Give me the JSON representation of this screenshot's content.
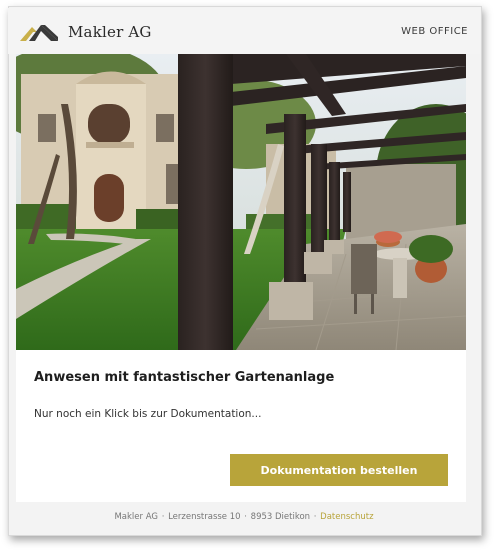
{
  "header": {
    "brand": "Makler AG",
    "logo_icon": "house-roof-logo-icon",
    "web_office_label": "WEB OFFICE"
  },
  "hero": {
    "image": "villa-garden-pergola-photo"
  },
  "content": {
    "title": "Anwesen mit fantastischer Gartenanlage",
    "subtitle": "Nur noch ein Klick bis zur Dokumentation...",
    "cta_label": "Dokumentation bestellen"
  },
  "footer": {
    "company": "Makler AG",
    "separator": "·",
    "address": "Lerzenstrasse 10",
    "city": "8953 Dietikon",
    "privacy_link": "Datenschutz"
  },
  "colors": {
    "accent": "#b8a43a",
    "header_bg": "#f4f4f4",
    "text_dark": "#1e1e1e"
  }
}
